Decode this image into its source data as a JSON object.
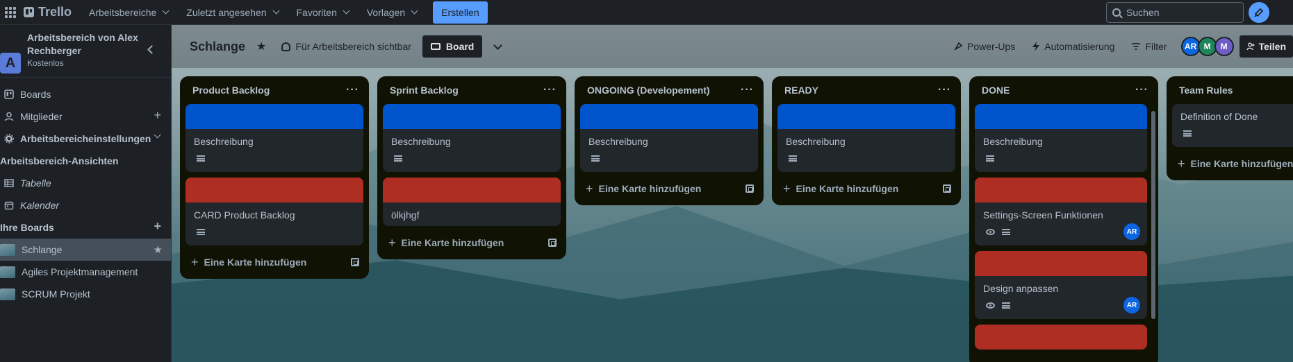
{
  "topbar": {
    "logo": "Trello",
    "nav": [
      "Arbeitsbereiche",
      "Zuletzt angesehen",
      "Favoriten",
      "Vorlagen"
    ],
    "create_label": "Erstellen",
    "search_placeholder": "Suchen"
  },
  "sidebar": {
    "workspace_initial": "A",
    "workspace_name": "Arbeitsbereich von Alex Rechberger",
    "workspace_plan": "Kostenlos",
    "items": [
      {
        "label": "Boards",
        "icon": "board-icon"
      },
      {
        "label": "Mitglieder",
        "icon": "members-icon"
      },
      {
        "label": "Arbeitsbereicheinstellungen",
        "icon": "gear-icon"
      }
    ],
    "views_title": "Arbeitsbereich-Ansichten",
    "views": [
      {
        "label": "Tabelle",
        "icon": "table-icon"
      },
      {
        "label": "Kalender",
        "icon": "calendar-icon"
      }
    ],
    "boards_title": "Ihre Boards",
    "boards": [
      {
        "label": "Schlange",
        "active": true
      },
      {
        "label": "Agiles Projektmanagement",
        "active": false
      },
      {
        "label": "SCRUM Projekt",
        "active": false
      }
    ]
  },
  "board": {
    "title": "Schlange",
    "visibility": "Für Arbeitsbereich sichtbar",
    "view_label": "Board",
    "power_ups": "Power-Ups",
    "automation": "Automatisierung",
    "filter": "Filter",
    "members": [
      {
        "initials": "AR",
        "color": "#0c66e4"
      },
      {
        "initials": "M",
        "color": "#1f845a"
      },
      {
        "initials": "M",
        "color": "#6e5dc6"
      }
    ],
    "share_label": "Teilen"
  },
  "colors": {
    "blue_cover": "#0055cc",
    "red_cover": "#ae2e24",
    "accent": "#579dff"
  },
  "lists": [
    {
      "title": "Product Backlog",
      "cards": [
        {
          "title": "Beschreibung",
          "cover": "blue",
          "desc": true,
          "watch": false,
          "member": ""
        },
        {
          "title": "CARD Product Backlog",
          "cover": "red",
          "desc": true,
          "watch": false,
          "member": ""
        }
      ],
      "add_label": "Eine Karte hinzufügen"
    },
    {
      "title": "Sprint Backlog",
      "cards": [
        {
          "title": "Beschreibung",
          "cover": "blue",
          "desc": true,
          "watch": false,
          "member": ""
        },
        {
          "title": "ölkjhgf",
          "cover": "red",
          "desc": false,
          "watch": false,
          "member": ""
        }
      ],
      "add_label": "Eine Karte hinzufügen"
    },
    {
      "title": "ONGOING (Developement)",
      "cards": [
        {
          "title": "Beschreibung",
          "cover": "blue",
          "desc": true,
          "watch": false,
          "member": ""
        }
      ],
      "add_label": "Eine Karte hinzufügen"
    },
    {
      "title": "READY",
      "cards": [
        {
          "title": "Beschreibung",
          "cover": "blue",
          "desc": true,
          "watch": false,
          "member": ""
        }
      ],
      "add_label": "Eine Karte hinzufügen"
    },
    {
      "title": "DONE",
      "cards": [
        {
          "title": "Beschreibung",
          "cover": "blue",
          "desc": true,
          "watch": false,
          "member": ""
        },
        {
          "title": "Settings-Screen Funktionen",
          "cover": "red",
          "desc": true,
          "watch": true,
          "member": "AR"
        },
        {
          "title": "Design anpassen",
          "cover": "red",
          "desc": true,
          "watch": true,
          "member": "AR"
        },
        {
          "title": "",
          "cover": "red",
          "desc": false,
          "watch": false,
          "member": ""
        }
      ],
      "add_label": ""
    },
    {
      "title": "Team Rules",
      "cards": [
        {
          "title": "Definition of Done",
          "cover": "",
          "desc": true,
          "watch": false,
          "member": ""
        }
      ],
      "add_label": "Eine Karte hinzufügen"
    }
  ]
}
